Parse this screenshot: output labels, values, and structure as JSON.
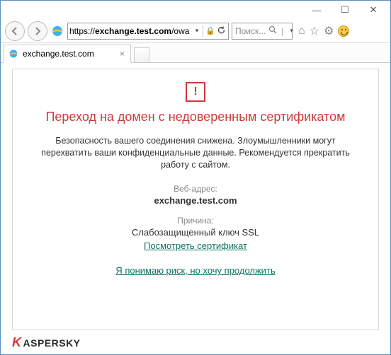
{
  "window": {
    "minimize": "—",
    "maximize": "☐",
    "close": "✕"
  },
  "nav": {
    "back": "⟵",
    "forward": "⟶",
    "refresh": "↻"
  },
  "address": {
    "scheme": "https://",
    "host_bold": "exchange.test.com",
    "path": "/owa",
    "lock": "🔒"
  },
  "search": {
    "placeholder": "Поиск...",
    "icon": "🔍"
  },
  "toolbar_icons": {
    "home": "⌂",
    "favorites": "☆",
    "settings": "⚙"
  },
  "tab": {
    "title": "exchange.test.com",
    "close": "×"
  },
  "warning": {
    "mark": "!",
    "heading": "Переход на домен с недоверенным сертификатом",
    "description": "Безопасность вашего соединения снижена. Злоумышленники могут перехватить ваши конфиденциальные данные. Рекомендуется прекратить работу с сайтом.",
    "address_label": "Веб-адрес:",
    "address_value": "exchange.test.com",
    "reason_label": "Причина:",
    "reason_value": "Слабозащищенный ключ SSL",
    "view_cert": "Посмотреть сертификат",
    "proceed": "Я понимаю риск, но хочу продолжить"
  },
  "brand": {
    "k": "K",
    "rest": "ASPERSKY"
  }
}
